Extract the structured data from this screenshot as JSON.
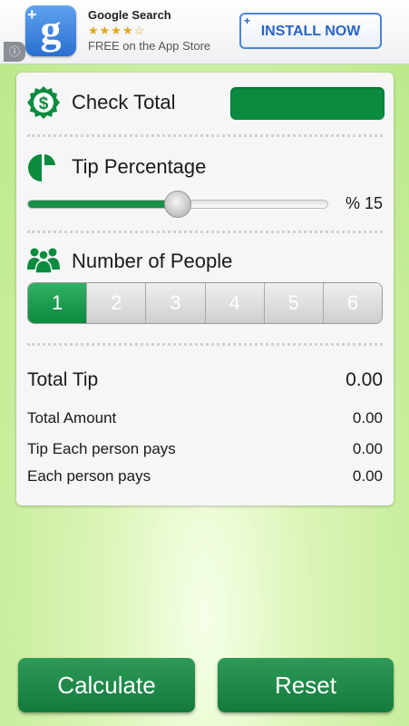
{
  "ad": {
    "title": "Google Search",
    "stars": "★★★★☆",
    "subtitle": "FREE on the App Store",
    "install_label": "INSTALL NOW",
    "install_plus": "+",
    "logo_letter": "g",
    "logo_plus": "+",
    "corner_icon": "ⓘ"
  },
  "check_total": {
    "label": "Check Total",
    "value": "",
    "icon": "dollar-badge-icon"
  },
  "tip": {
    "label": "Tip Percentage",
    "value_text": "% 15",
    "slider_value": 15,
    "slider_min": 0,
    "slider_max": 30,
    "icon": "pie-chart-icon"
  },
  "people": {
    "label": "Number of People",
    "options": [
      "1",
      "2",
      "3",
      "4",
      "5",
      "6"
    ],
    "selected": "1",
    "icon": "people-icon"
  },
  "results": {
    "total_tip": {
      "label": "Total Tip",
      "value": "0.00"
    },
    "total_amount": {
      "label": "Total Amount",
      "value": "0.00"
    },
    "tip_each": {
      "label": "Tip Each person pays",
      "value": "0.00"
    },
    "each_pays": {
      "label": "Each person pays",
      "value": "0.00"
    }
  },
  "buttons": {
    "calculate": "Calculate",
    "reset": "Reset"
  },
  "colors": {
    "accent": "#0a8b40",
    "background": "#c8ee9e"
  }
}
